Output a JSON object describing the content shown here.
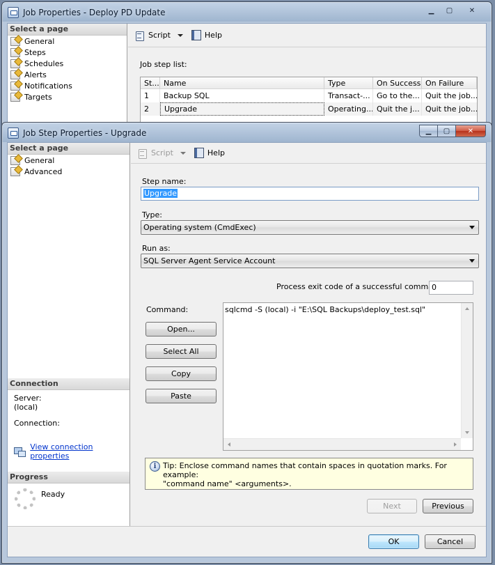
{
  "job_window": {
    "title": "Job Properties - Deploy PD Update",
    "select_page_header": "Select a page",
    "pages": [
      "General",
      "Steps",
      "Schedules",
      "Alerts",
      "Notifications",
      "Targets"
    ],
    "toolbar": {
      "script": "Script",
      "help": "Help"
    },
    "job_step_list_label": "Job step list:",
    "grid": {
      "headers": [
        "St...",
        "Name",
        "Type",
        "On Success",
        "On Failure"
      ],
      "rows": [
        [
          "1",
          "Backup SQL",
          "Transact-...",
          "Go to the...",
          "Quit the job..."
        ],
        [
          "2",
          "Upgrade",
          "Operating...",
          "Quit the j...",
          "Quit the job..."
        ]
      ]
    }
  },
  "step_window": {
    "title": "Job Step Properties - Upgrade",
    "select_page_header": "Select a page",
    "pages": [
      "General",
      "Advanced"
    ],
    "toolbar": {
      "script": "Script",
      "help": "Help"
    },
    "connection": {
      "header": "Connection",
      "server_label": "Server:",
      "server_value": "(local)",
      "connection_label": "Connection:",
      "connection_value": "",
      "view_link": "View connection properties"
    },
    "progress": {
      "header": "Progress",
      "status": "Ready"
    },
    "form": {
      "step_name_label": "Step name:",
      "step_name_value": "Upgrade",
      "type_label": "Type:",
      "type_value": "Operating system (CmdExec)",
      "run_as_label": "Run as:",
      "run_as_value": "SQL Server Agent Service Account",
      "exit_code_label": "Process exit code of a successful command:",
      "exit_code_value": "0",
      "command_label": "Command:",
      "command_value": "sqlcmd -S (local) -i \"E:\\SQL Backups\\deploy_test.sql\"",
      "buttons": {
        "open": "Open...",
        "select_all": "Select All",
        "copy": "Copy",
        "paste": "Paste"
      },
      "tip_line1": "Tip: Enclose command names that contain spaces in quotation marks. For example:",
      "tip_line2": "\"command name\" <arguments>."
    },
    "nav": {
      "next": "Next",
      "previous": "Previous"
    },
    "footer": {
      "ok": "OK",
      "cancel": "Cancel"
    }
  }
}
